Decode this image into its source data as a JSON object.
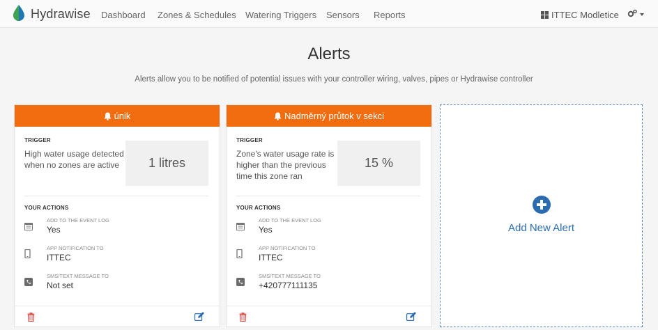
{
  "nav": {
    "brand": "Hydrawise",
    "items": [
      "Dashboard",
      "Zones & Schedules",
      "Watering Triggers",
      "Sensors",
      "Reports"
    ],
    "org": "ITTEC Modletice",
    "settings_icon": "gears-icon"
  },
  "header": {
    "title": "Alerts",
    "subtitle": "Alerts allow you to be notified of potential issues with your controller wiring, valves, pipes or Hydrawise controller"
  },
  "cards": [
    {
      "title": "únik",
      "trigger_label": "TRIGGER",
      "trigger_desc": "High water usage detected when no zones are active",
      "trigger_value": "1 litres",
      "actions_label": "YOUR ACTIONS",
      "actions": [
        {
          "label": "ADD TO THE EVENT LOG",
          "value": "Yes",
          "icon": "event-log-icon"
        },
        {
          "label": "APP NOTIFICATION TO",
          "value": "ITTEC",
          "icon": "phone-icon"
        },
        {
          "label": "SMS/TEXT MESSAGE TO",
          "value": "Not set",
          "icon": "phone-square-icon"
        }
      ]
    },
    {
      "title": "Nadměrný průtok v sekci",
      "trigger_label": "TRIGGER",
      "trigger_desc": "Zone's water usage rate is higher than the previous time this zone ran",
      "trigger_value": "15 %",
      "actions_label": "YOUR ACTIONS",
      "actions": [
        {
          "label": "ADD TO THE EVENT LOG",
          "value": "Yes",
          "icon": "event-log-icon"
        },
        {
          "label": "APP NOTIFICATION TO",
          "value": "ITTEC",
          "icon": "phone-icon"
        },
        {
          "label": "SMS/TEXT MESSAGE TO",
          "value": "+420777111135",
          "icon": "phone-square-icon"
        }
      ]
    }
  ],
  "new_alert": {
    "label": "Add New Alert"
  },
  "colors": {
    "accent": "#f26d0f",
    "link": "#2b6cb0",
    "delete": "#d9534f"
  }
}
